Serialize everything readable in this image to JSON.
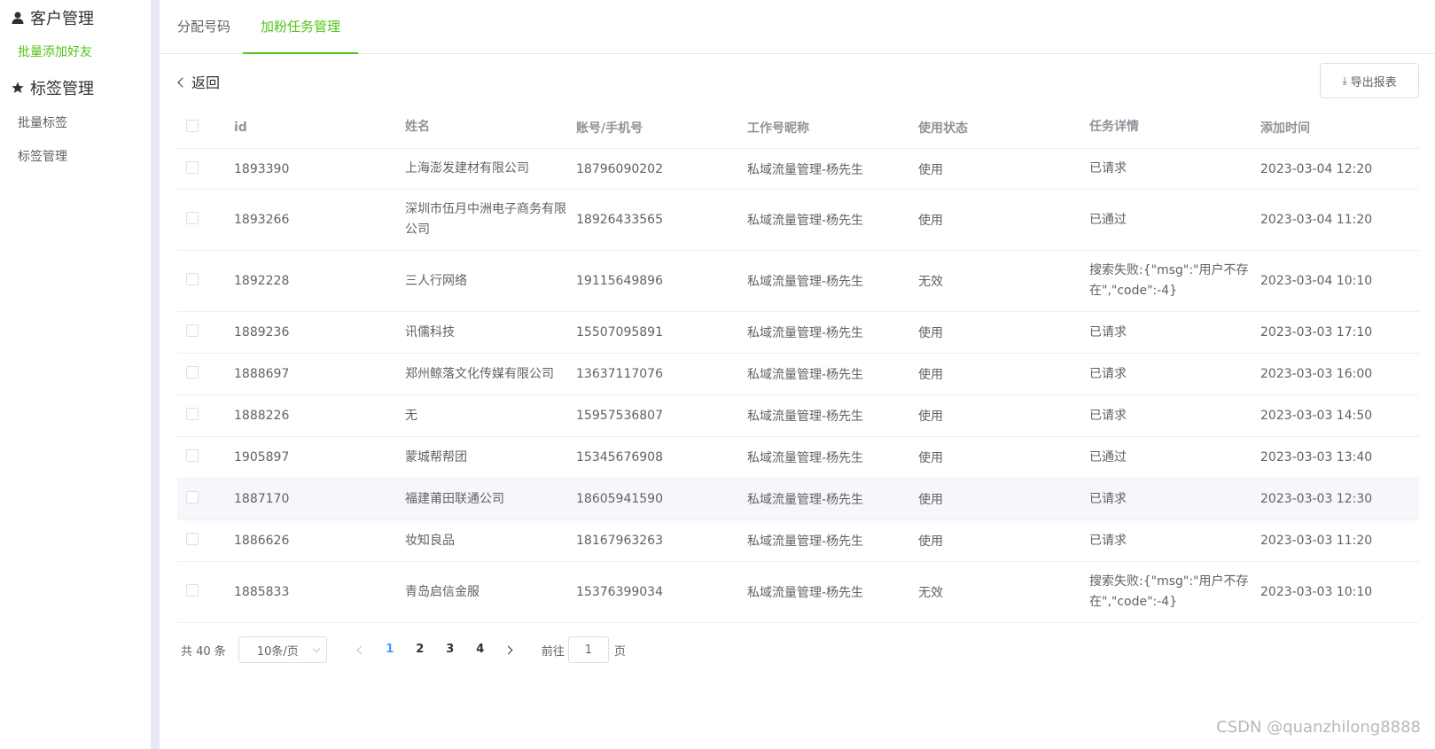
{
  "sidebar": {
    "groups": [
      {
        "label": "客户管理",
        "icon": "user-icon",
        "items": [
          {
            "label": "批量添加好友",
            "active": true
          }
        ]
      },
      {
        "label": "标签管理",
        "icon": "star-icon",
        "items": [
          {
            "label": "批量标签"
          },
          {
            "label": "标签管理"
          }
        ]
      }
    ]
  },
  "tabs": [
    {
      "label": "分配号码"
    },
    {
      "label": "加粉任务管理",
      "active": true
    }
  ],
  "toolbar": {
    "back_label": "返回",
    "export_label": "导出报表",
    "export_icon": "download-icon"
  },
  "table": {
    "headers": {
      "id": "id",
      "name": "姓名",
      "phone": "账号/手机号",
      "nick": "工作号昵称",
      "status": "使用状态",
      "detail": "任务详情",
      "time": "添加时间"
    },
    "rows": [
      {
        "id": "1893390",
        "name": "上海澎发建材有限公司",
        "phone": "18796090202",
        "nick": "私域流量管理-杨先生",
        "status": "使用",
        "detail": "已请求",
        "time": "2023-03-04 12:20"
      },
      {
        "id": "1893266",
        "name": "深圳市伍月中洲电子商务有限公司",
        "phone": "18926433565",
        "nick": "私域流量管理-杨先生",
        "status": "使用",
        "detail": "已通过",
        "time": "2023-03-04 11:20"
      },
      {
        "id": "1892228",
        "name": "三人行网络",
        "phone": "19115649896",
        "nick": "私域流量管理-杨先生",
        "status": "无效",
        "detail": "搜索失败:{\"msg\":\"用户不存在\",\"code\":-4}",
        "time": "2023-03-04 10:10"
      },
      {
        "id": "1889236",
        "name": "讯儒科技",
        "phone": "15507095891",
        "nick": "私域流量管理-杨先生",
        "status": "使用",
        "detail": "已请求",
        "time": "2023-03-03 17:10"
      },
      {
        "id": "1888697",
        "name": "郑州鲸落文化传媒有限公司",
        "phone": "13637117076",
        "nick": "私域流量管理-杨先生",
        "status": "使用",
        "detail": "已请求",
        "time": "2023-03-03 16:00"
      },
      {
        "id": "1888226",
        "name": "无",
        "phone": "15957536807",
        "nick": "私域流量管理-杨先生",
        "status": "使用",
        "detail": "已请求",
        "time": "2023-03-03 14:50"
      },
      {
        "id": "1905897",
        "name": "蒙城帮帮团",
        "phone": "15345676908",
        "nick": "私域流量管理-杨先生",
        "status": "使用",
        "detail": "已通过",
        "time": "2023-03-03 13:40"
      },
      {
        "id": "1887170",
        "name": "福建莆田联通公司",
        "phone": "18605941590",
        "nick": "私域流量管理-杨先生",
        "status": "使用",
        "detail": "已请求",
        "time": "2023-03-03 12:30"
      },
      {
        "id": "1886626",
        "name": "妆知良品",
        "phone": "18167963263",
        "nick": "私域流量管理-杨先生",
        "status": "使用",
        "detail": "已请求",
        "time": "2023-03-03 11:20"
      },
      {
        "id": "1885833",
        "name": "青岛启信金服",
        "phone": "15376399034",
        "nick": "私域流量管理-杨先生",
        "status": "无效",
        "detail": "搜索失败:{\"msg\":\"用户不存在\",\"code\":-4}",
        "time": "2023-03-03 10:10"
      }
    ]
  },
  "pagination": {
    "total_label": "共 40 条",
    "page_size_label": "10条/页",
    "pages": [
      "1",
      "2",
      "3",
      "4"
    ],
    "current_page": "1",
    "goto_prefix": "前往",
    "goto_value": "1",
    "goto_suffix": "页"
  },
  "watermark": "CSDN @quanzhilong8888",
  "colors": {
    "accent": "#52c41a",
    "active_page": "#409eff",
    "divider": "#e6e8f8"
  }
}
